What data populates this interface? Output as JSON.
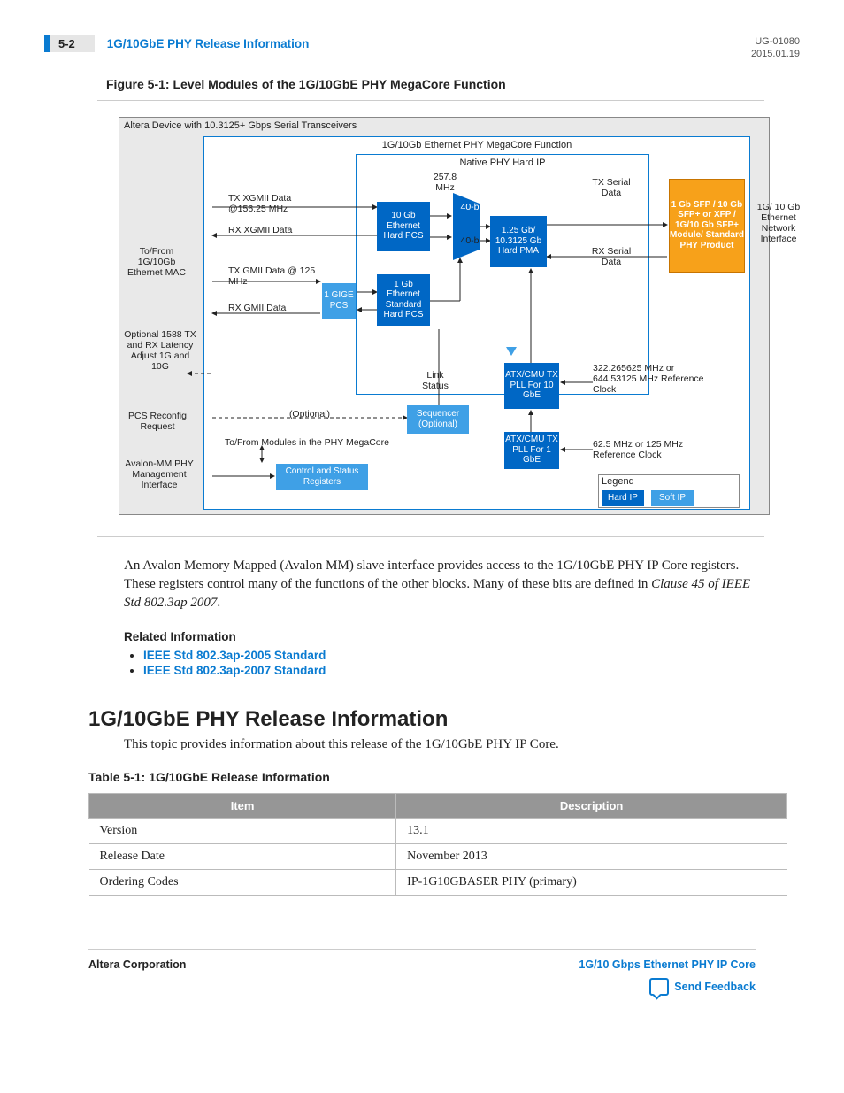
{
  "header": {
    "page_number": "5-2",
    "running_title": "1G/10GbE PHY Release Information",
    "doc_id": "UG-01080",
    "date": "2015.01.19"
  },
  "figure": {
    "caption": "Figure 5-1: Level Modules of the 1G/10GbE PHY MegaCore Function",
    "outer_title": "Altera Device with 10.3125+ Gbps Serial Transceivers",
    "mc_title": "1G/10Gb Ethernet PHY MegaCore Function",
    "native_title": "Native PHY Hard IP",
    "blocks": {
      "hard_pcs_10g": "10 Gb Ethernet Hard PCS",
      "hard_pcs_1g": "1 Gb Ethernet Standard Hard PCS",
      "gige_pcs": "1 GIGE PCS",
      "hard_pma": "1.25 Gb/ 10.3125 Gb Hard PMA",
      "sequencer": "Sequencer (Optional)",
      "atx_10g": "ATX/CMU TX PLL For 10 GbE",
      "atx_1g": "ATX/CMU TX PLL For 1 GbE",
      "csr": "Control and Status Registers",
      "sfp": "1 Gb SFP / 10 Gb SFP+ or XFP / 1G/10 Gb SFP+ Module/ Standard PHY Product"
    },
    "labels": {
      "mhz257": "257.8 MHz",
      "b40_top": "40-b",
      "b40_bot": "40-b",
      "tx_xgmii": "TX XGMII Data @156.25 MHz",
      "rx_xgmii": "RX XGMII Data",
      "tx_gmii": "TX GMII Data @ 125 MHz",
      "rx_gmii": "RX GMII Data",
      "to_from_mac": "To/From 1G/10Gb Ethernet MAC",
      "optional_1588": "Optional 1588 TX and RX Latency Adjust 1G and 10G",
      "pcs_reconfig": "PCS Reconfig Request",
      "avalon_mm": "Avalon-MM PHY Management Interface",
      "link_status": "Link Status",
      "optional_seq": "(Optional)",
      "tx_serial": "TX Serial Data",
      "rx_serial": "RX Serial Data",
      "net_iface": "1G/ 10 Gb Ethernet Network Interface",
      "ref_10g": "322.265625 MHz or 644.53125 MHz Reference Clock",
      "ref_1g": "62.5 MHz or 125 MHz Reference Clock",
      "to_from_modules": "To/From Modules in the PHY MegaCore"
    },
    "legend": {
      "title": "Legend",
      "hard": "Hard IP",
      "soft": "Soft IP"
    }
  },
  "body": {
    "paragraph_html": "An Avalon Memory Mapped (Avalon MM) slave interface provides access to the 1G/10GbE PHY IP Core registers. These registers control many of the functions of the other blocks. Many of these bits are defined in <em>Clause 45 of IEEE Std 802.3ap 2007</em>."
  },
  "related": {
    "heading": "Related Information",
    "links": [
      "IEEE Std 802.3ap-2005 Standard",
      "IEEE Std 802.3ap-2007 Standard"
    ]
  },
  "section": {
    "heading": "1G/10GbE PHY Release Information",
    "intro": "This topic provides information about this release of the 1G/10GbE PHY IP Core."
  },
  "table": {
    "caption": "Table 5-1: 1G/10GbE Release Information",
    "headers": [
      "Item",
      "Description"
    ],
    "rows": [
      [
        "Version",
        "13.1"
      ],
      [
        "Release Date",
        "November 2013"
      ],
      [
        "Ordering Codes",
        "IP-1G10GBASER PHY (primary)"
      ]
    ]
  },
  "footer": {
    "left": "Altera Corporation",
    "right_title": "1G/10 Gbps Ethernet PHY IP Core",
    "feedback": "Send Feedback"
  }
}
